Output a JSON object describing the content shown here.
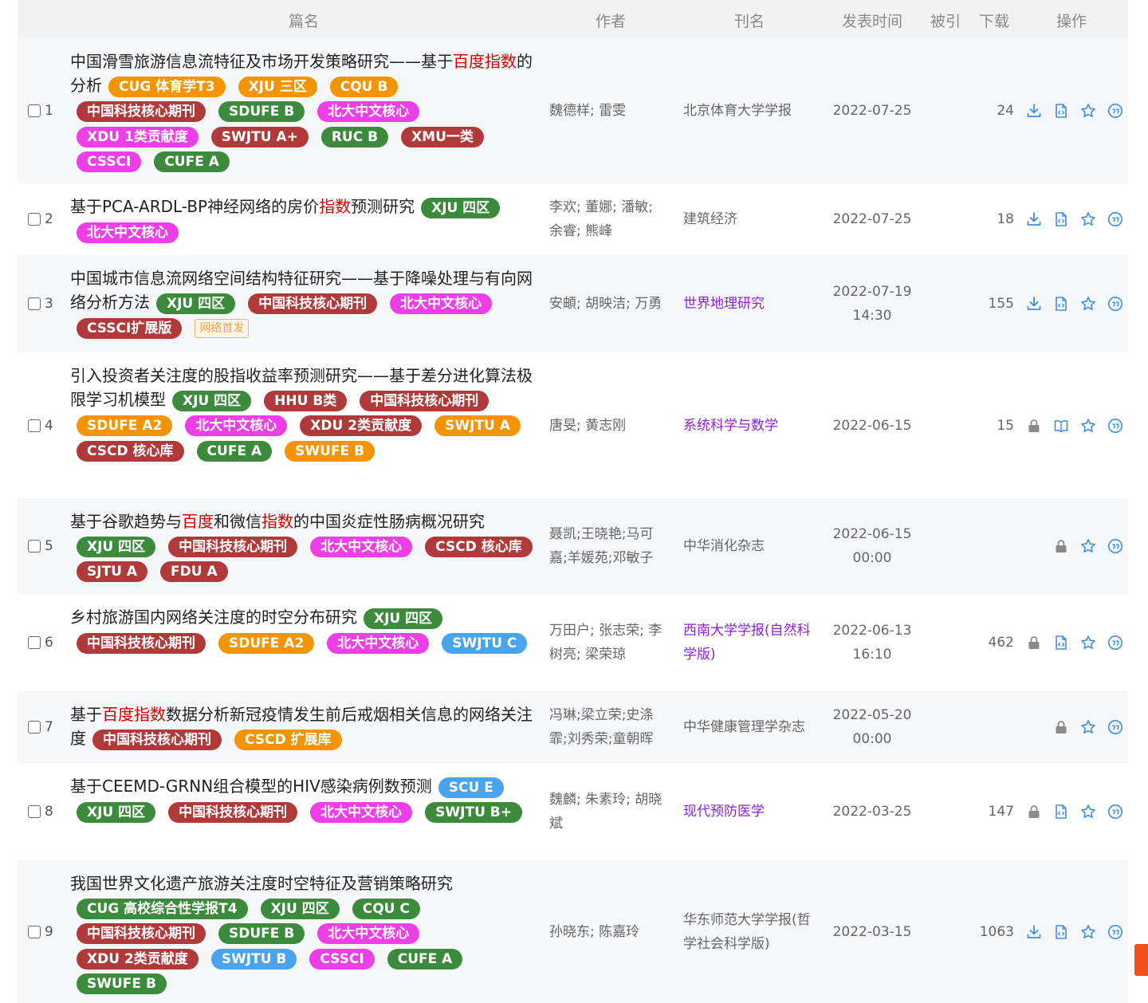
{
  "header": {
    "title": "篇名",
    "authors": "作者",
    "journal": "刊名",
    "date": "发表时间",
    "cited": "被引",
    "downloads": "下载",
    "ops": "操作"
  },
  "colors": {
    "green": "#3c8a3c",
    "red": "#b03a3a",
    "magenta": "#ee3ee8",
    "orange": "#f39400",
    "blue": "#4aa3ee",
    "highlight": "#d40000",
    "journal_link": "#8b1fd9",
    "icon": "#3f8fe0"
  },
  "rows": [
    {
      "index": "1",
      "title": [
        {
          "t": "中国滑雪旅游信息流特征及市场开发策略研究——基于"
        },
        {
          "t": "百度指数",
          "hl": true
        },
        {
          "t": "的分析"
        }
      ],
      "tags": [
        {
          "label": "CUG 体育学T3",
          "color": "orange"
        },
        {
          "label": "XJU 三区",
          "color": "orange"
        },
        {
          "label": "CQU B",
          "color": "orange"
        },
        {
          "label": "中国科技核心期刊",
          "color": "red"
        },
        {
          "label": "SDUFE B",
          "color": "green"
        },
        {
          "label": "北大中文核心",
          "color": "magenta"
        },
        {
          "label": "XDU 1类贡献度",
          "color": "magenta"
        },
        {
          "label": "SWJTU A+",
          "color": "red"
        },
        {
          "label": "RUC B",
          "color": "green"
        },
        {
          "label": "XMU一类",
          "color": "red"
        },
        {
          "label": "CSSCI",
          "color": "magenta"
        },
        {
          "label": "CUFE A",
          "color": "green"
        }
      ],
      "authors": "魏德样; 雷雯",
      "journal": "北京体育大学学报",
      "journal_link": false,
      "date": "2022-07-25",
      "downloads": "24",
      "icons": [
        "download-icon",
        "html-read-icon",
        "favorite-star-icon",
        "cite-quote-icon"
      ]
    },
    {
      "index": "2",
      "title": [
        {
          "t": "基于PCA-ARDL-BP神经网络的房价"
        },
        {
          "t": "指数",
          "hl": true
        },
        {
          "t": "预测研究"
        }
      ],
      "tags": [
        {
          "label": "XJU 四区",
          "color": "green"
        },
        {
          "label": "北大中文核心",
          "color": "magenta"
        }
      ],
      "authors": "李欢; 董娜; 潘敏; 余睿; 熊峰",
      "journal": "建筑经济",
      "journal_link": false,
      "date": "2022-07-25",
      "downloads": "18",
      "icons": [
        "download-icon",
        "html-read-icon",
        "favorite-star-icon",
        "cite-quote-icon"
      ]
    },
    {
      "index": "3",
      "title": [
        {
          "t": "中国城市信息流网络空间结构特征研究——基于降噪处理与有向网络分析方法"
        }
      ],
      "tags": [
        {
          "label": "XJU 四区",
          "color": "green"
        },
        {
          "label": "中国科技核心期刊",
          "color": "red"
        },
        {
          "label": "北大中文核心",
          "color": "magenta"
        },
        {
          "label": "CSSCI扩展版",
          "color": "red"
        },
        {
          "label": "网络首发",
          "color": "netfirst"
        }
      ],
      "authors": "安頔; 胡映洁; 万勇",
      "journal": "世界地理研究",
      "journal_link": true,
      "date": "2022-07-19 14:30",
      "downloads": "155",
      "icons": [
        "download-icon",
        "html-read-icon",
        "favorite-star-icon",
        "cite-quote-icon"
      ]
    },
    {
      "index": "4",
      "title": [
        {
          "t": "引入投资者关注度的股指收益率预测研究——基于差分进化算法极限学习机模型"
        }
      ],
      "tags": [
        {
          "label": "XJU 四区",
          "color": "green"
        },
        {
          "label": "HHU B类",
          "color": "red"
        },
        {
          "label": "中国科技核心期刊",
          "color": "red"
        },
        {
          "label": "SDUFE A2",
          "color": "orange"
        },
        {
          "label": "北大中文核心",
          "color": "magenta"
        },
        {
          "label": "XDU 2类贡献度",
          "color": "red"
        },
        {
          "label": "SWJTU A",
          "color": "orange"
        },
        {
          "label": "CSCD 核心库",
          "color": "red"
        },
        {
          "label": "CUFE A",
          "color": "green"
        },
        {
          "label": "SWUFE B",
          "color": "orange"
        }
      ],
      "authors": "唐旻; 黄志刚",
      "journal": "系统科学与数学",
      "journal_link": true,
      "date": "2022-06-15",
      "downloads": "15",
      "icons": [
        "lock-icon",
        "book-read-icon",
        "favorite-star-icon",
        "cite-quote-icon"
      ]
    },
    {
      "index": "5",
      "title": [
        {
          "t": "基于谷歌趋势与"
        },
        {
          "t": "百度",
          "hl": true
        },
        {
          "t": "和微信"
        },
        {
          "t": "指数",
          "hl": true
        },
        {
          "t": "的中国炎症性肠病概况研究"
        }
      ],
      "tags": [
        {
          "label": "XJU 四区",
          "color": "green"
        },
        {
          "label": "中国科技核心期刊",
          "color": "red"
        },
        {
          "label": "北大中文核心",
          "color": "magenta"
        },
        {
          "label": "CSCD 核心库",
          "color": "red"
        },
        {
          "label": "SJTU A",
          "color": "red"
        },
        {
          "label": "FDU A",
          "color": "red"
        }
      ],
      "authors": "聂凯;王晓艳;马可嘉;羊媛苑;邓敏子",
      "journal": "中华消化杂志",
      "journal_link": false,
      "date": "2022-06-15 00:00",
      "downloads": "",
      "icons": [
        "lock-icon",
        "favorite-star-icon",
        "cite-quote-icon"
      ]
    },
    {
      "index": "6",
      "title": [
        {
          "t": "乡村旅游国内网络关注度的时空分布研究"
        }
      ],
      "tags": [
        {
          "label": "XJU 四区",
          "color": "green"
        },
        {
          "label": "中国科技核心期刊",
          "color": "red"
        },
        {
          "label": "SDUFE A2",
          "color": "orange"
        },
        {
          "label": "北大中文核心",
          "color": "magenta"
        },
        {
          "label": "SWJTU C",
          "color": "blue"
        }
      ],
      "authors": "万田户; 张志荣; 李树亮; 梁荣琼",
      "journal": "西南大学学报(自然科学版)",
      "journal_link": true,
      "date": "2022-06-13 16:10",
      "downloads": "462",
      "icons": [
        "lock-icon",
        "html-read-icon",
        "favorite-star-icon",
        "cite-quote-icon"
      ]
    },
    {
      "index": "7",
      "title": [
        {
          "t": "基于"
        },
        {
          "t": "百度指数",
          "hl": true
        },
        {
          "t": "数据分析新冠疫情发生前后戒烟相关信息的网络关注度"
        }
      ],
      "tags": [
        {
          "label": "中国科技核心期刊",
          "color": "red"
        },
        {
          "label": "CSCD 扩展库",
          "color": "orange"
        }
      ],
      "authors": "冯琳;梁立荣;史涤霏;刘秀荣;童朝晖",
      "journal": "中华健康管理学杂志",
      "journal_link": false,
      "date": "2022-05-20 00:00",
      "downloads": "",
      "icons": [
        "lock-icon",
        "favorite-star-icon",
        "cite-quote-icon"
      ]
    },
    {
      "index": "8",
      "title": [
        {
          "t": "基于CEEMD-GRNN组合模型的HIV感染病例数预测"
        }
      ],
      "tags": [
        {
          "label": "SCU E",
          "color": "blue"
        },
        {
          "label": "XJU 四区",
          "color": "green"
        },
        {
          "label": "中国科技核心期刊",
          "color": "red"
        },
        {
          "label": "北大中文核心",
          "color": "magenta"
        },
        {
          "label": "SWJTU B+",
          "color": "green"
        }
      ],
      "authors": "魏麟; 朱素玲; 胡晓斌",
      "journal": "现代预防医学",
      "journal_link": true,
      "date": "2022-03-25",
      "downloads": "147",
      "icons": [
        "lock-icon",
        "html-read-icon",
        "favorite-star-icon",
        "cite-quote-icon"
      ]
    },
    {
      "index": "9",
      "title": [
        {
          "t": "我国世界文化遗产旅游关注度时空特征及营销策略研究"
        }
      ],
      "tags": [
        {
          "label": "CUG 高校综合性学报T4",
          "color": "green"
        },
        {
          "label": "XJU 四区",
          "color": "green"
        },
        {
          "label": "CQU C",
          "color": "green"
        },
        {
          "label": "中国科技核心期刊",
          "color": "red"
        },
        {
          "label": "SDUFE B",
          "color": "green"
        },
        {
          "label": "北大中文核心",
          "color": "magenta"
        },
        {
          "label": "XDU 2类贡献度",
          "color": "red"
        },
        {
          "label": "SWJTU B",
          "color": "blue"
        },
        {
          "label": "CSSCI",
          "color": "magenta"
        },
        {
          "label": "CUFE A",
          "color": "green"
        },
        {
          "label": "SWUFE B",
          "color": "green"
        }
      ],
      "authors": "孙晓东; 陈嘉玲",
      "journal": "华东师范大学学报(哲学社会科学版)",
      "journal_link": false,
      "date": "2022-03-15",
      "downloads": "1063",
      "icons": [
        "download-icon",
        "html-read-icon",
        "favorite-star-icon",
        "cite-quote-icon"
      ]
    }
  ]
}
